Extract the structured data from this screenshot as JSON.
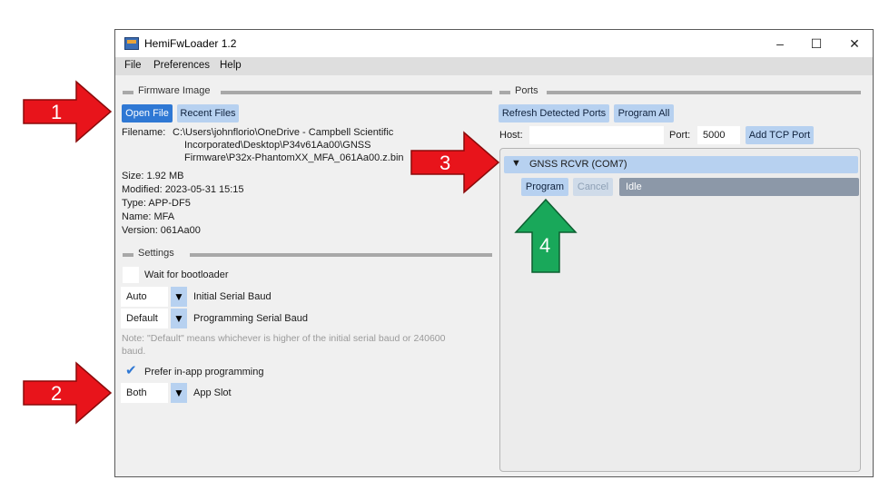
{
  "window": {
    "title": "HemiFwLoader 1.2",
    "controls": {
      "minimize": "–",
      "maximize": "☐",
      "close": "✕"
    }
  },
  "menu": [
    "File",
    "Preferences",
    "Help"
  ],
  "firmware": {
    "section_label": "Firmware Image",
    "open_file": "Open File",
    "recent_files": "Recent Files",
    "filename_label": "Filename:",
    "filename_lines": [
      "C:\\Users\\johnflorio\\OneDrive - Campbell Scientific",
      "Incorporated\\Desktop\\P34v61Aa00\\GNSS",
      "Firmware\\P32x-PhantomXX_MFA_061Aa00.z.bin"
    ],
    "size": "Size: 1.92 MB",
    "modified": "Modified: 2023-05-31 15:15",
    "type": "Type: APP-DF5",
    "name": "Name: MFA",
    "version": "Version: 061Aa00"
  },
  "settings": {
    "section_label": "Settings",
    "wait_bootloader": "Wait for bootloader",
    "initial_baud_value": "Auto",
    "initial_baud_label": "Initial Serial Baud",
    "programming_baud_value": "Default",
    "programming_baud_label": "Programming Serial Baud",
    "note_line1": "Note: \"Default\" means whichever is higher of the initial serial baud or 240600",
    "note_line2": "baud.",
    "prefer_inapp": "Prefer in-app programming",
    "prefer_inapp_checked": true,
    "app_slot_value": "Both",
    "app_slot_label": "App Slot"
  },
  "ports": {
    "section_label": "Ports",
    "refresh": "Refresh Detected Ports",
    "program_all": "Program All",
    "host_label": "Host:",
    "host_value": "",
    "port_label": "Port:",
    "port_value": "5000",
    "add_tcp": "Add TCP Port",
    "device_name": "GNSS RCVR (COM7)",
    "program": "Program",
    "cancel": "Cancel",
    "status": "Idle"
  },
  "annotations": [
    "1",
    "2",
    "3",
    "4"
  ],
  "colors": {
    "arrow_red": "#e8141b",
    "arrow_green": "#19a85a",
    "accent_blue": "#2f78d4",
    "button_blue": "#b7d1f0"
  }
}
